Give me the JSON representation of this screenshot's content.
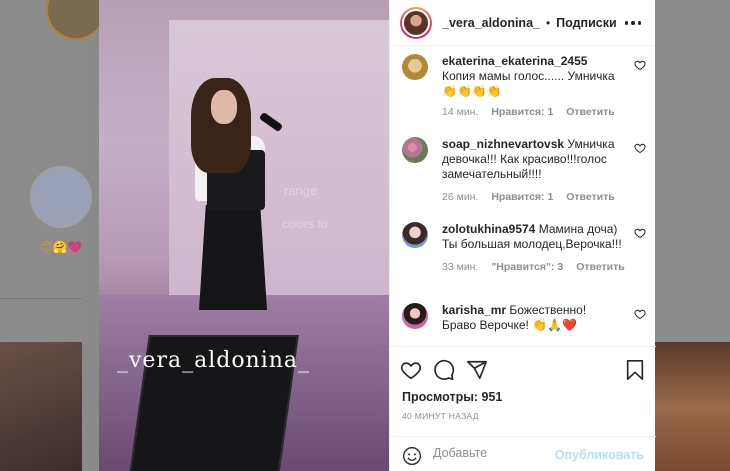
{
  "post": {
    "username": "_vera_aldonina_",
    "separator": "•",
    "follow_status": "Подписки",
    "watermark": "_vera_aldonina_",
    "screen_text_1": "range",
    "screen_text_2": "colors fo"
  },
  "comments": [
    {
      "username": "ekaterina_ekaterina_2455",
      "text": "Копия мамы голос...... Умничка 👏👏👏👏",
      "time": "14 мин.",
      "likes": "Нравится: 1",
      "reply": "Ответить"
    },
    {
      "username": "soap_nizhnevartovsk",
      "text": "Умничка девочка!!! Как красиво!!!голос замечательный!!!!",
      "time": "26 мин.",
      "likes": "Нравится: 1",
      "reply": "Ответить"
    },
    {
      "username": "zolotukhina9574",
      "text": "Мамина доча) Ты большая молодец,Верочка!!!",
      "time": "33 мин.",
      "likes": "\"Нравится\": 3",
      "reply": "Ответить"
    },
    {
      "username": "karisha_mr",
      "text": "Божественно! Браво Верочке! 👏🙏❤️"
    }
  ],
  "stats": {
    "views_label": "Просмотры:",
    "views_count": "951",
    "posted_time": "40 МИНУТ НАЗАД"
  },
  "add_comment": {
    "placeholder": "Добавьте",
    "publish_label": "Опубликовать"
  },
  "background": {
    "emoji_row": "😍🤗💗"
  },
  "colors": {
    "link_disabled": "#b2dffc",
    "meta_gray": "#8e8e8e",
    "text": "#262626"
  },
  "icons": [
    "heart-icon",
    "comment-icon",
    "share-icon",
    "bookmark-icon",
    "emoji-icon",
    "more-icon"
  ]
}
